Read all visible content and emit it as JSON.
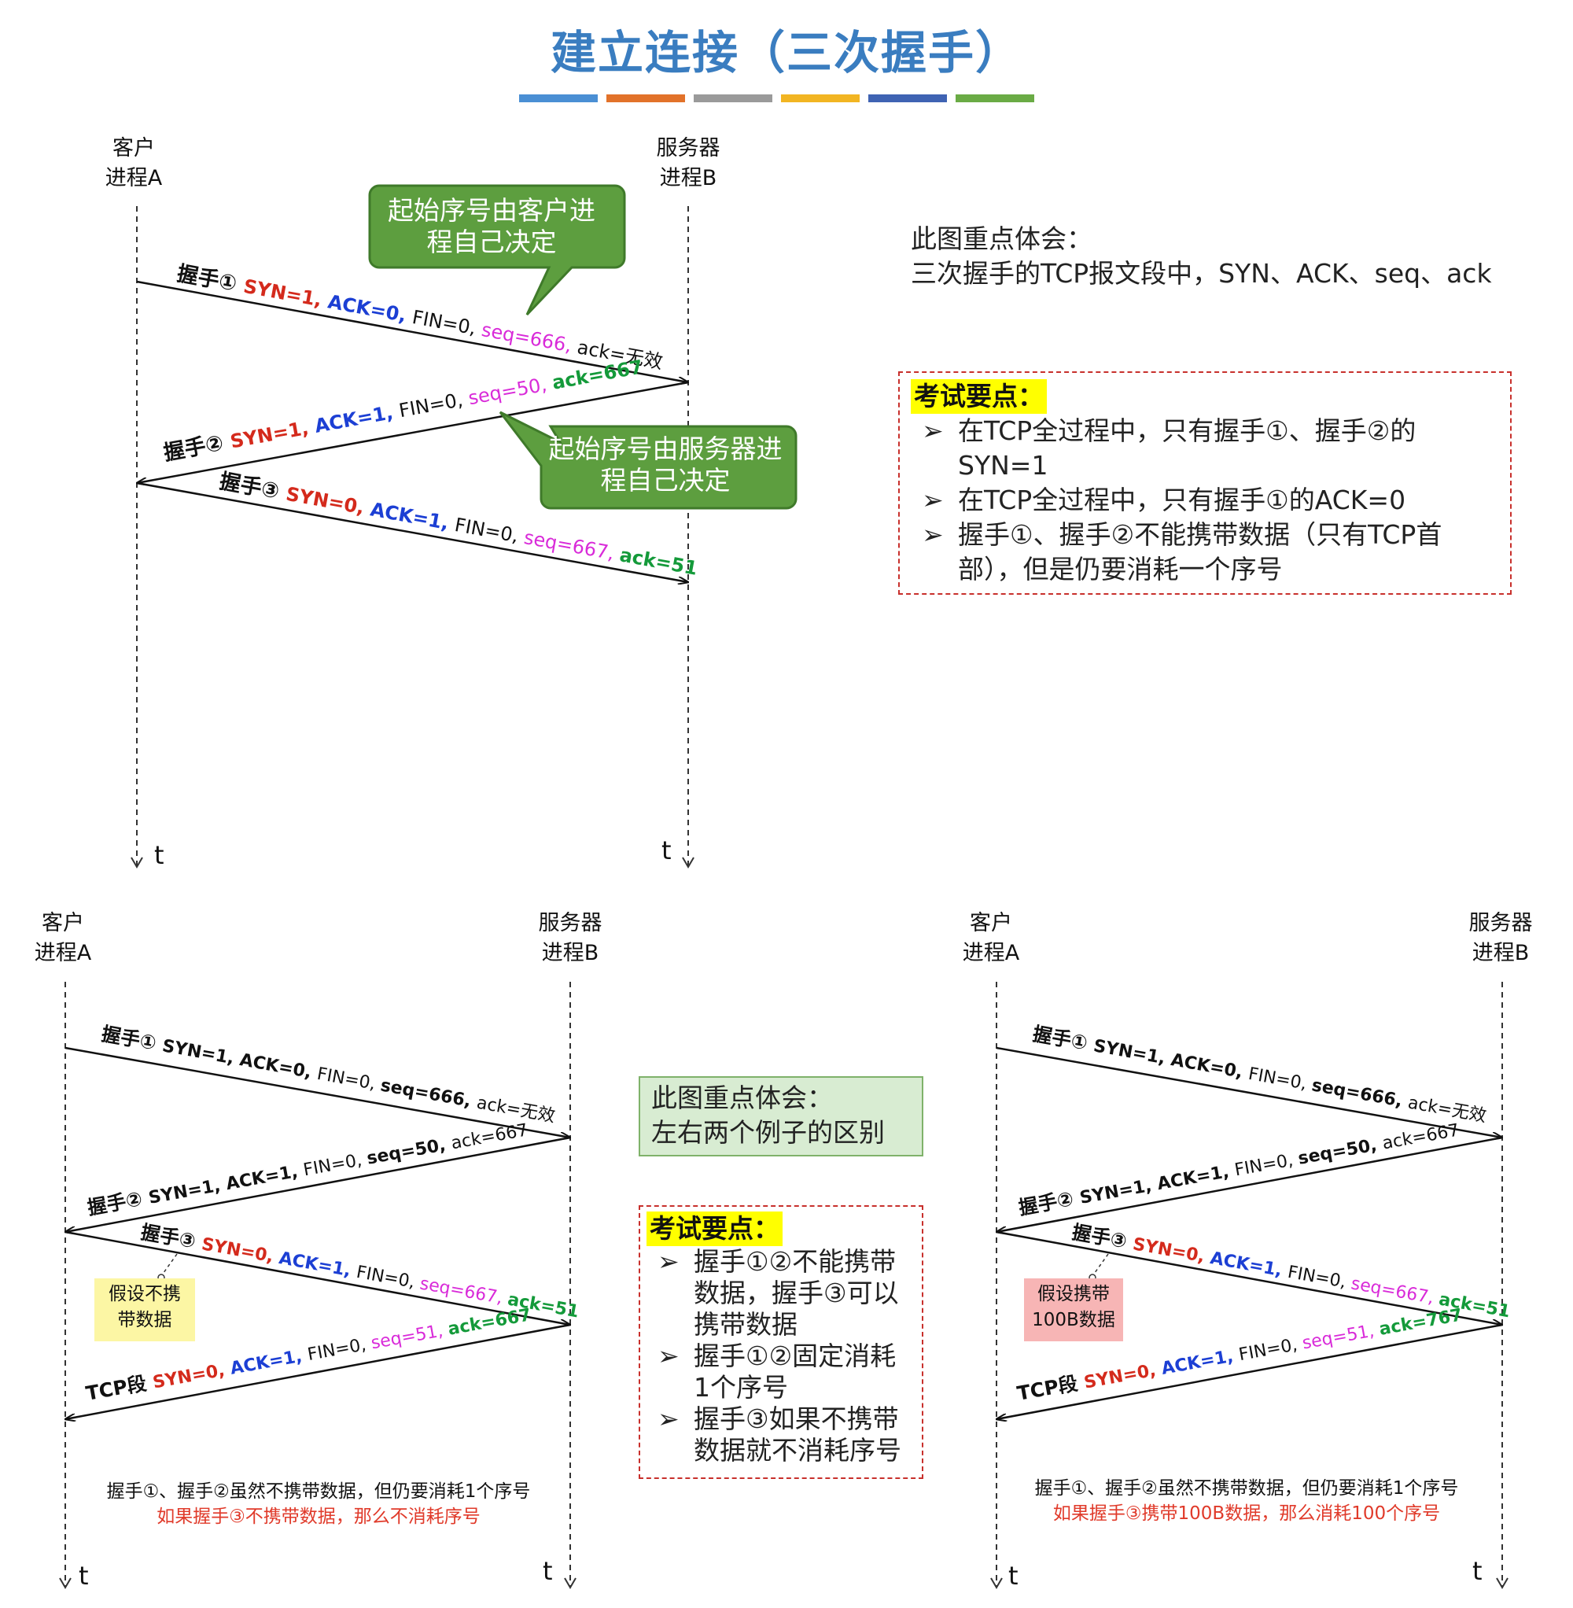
{
  "title": "建立连接（三次握手）",
  "title_bar_colors": [
    "#4a8fd4",
    "#e2722a",
    "#9a9a9a",
    "#f2b522",
    "#3f63b3",
    "#6aab45"
  ],
  "colors": {
    "syn": "#d42a1c",
    "ack": "#1c3fd4",
    "seq": "#d92bd9",
    "ack_val": "#149a3a",
    "bubble_fill": "#5d9e3f",
    "bubble_stroke": "#3f7a2a"
  },
  "top": {
    "client_label": [
      "客户",
      "进程A"
    ],
    "server_label": [
      "服务器",
      "进程B"
    ],
    "t_label": "t",
    "bubble1": "起始序号由客户进程自己决定",
    "bubble2": "起始序号由服务器进程自己决定",
    "msg1": {
      "name": "握手①",
      "syn": "SYN=1,",
      "ack": "ACK=0,",
      "fin": "FIN=0,",
      "seq": "seq=666,",
      "ackv": "ack=无效"
    },
    "msg2": {
      "name": "握手②",
      "syn": "SYN=1,",
      "ack": "ACK=1,",
      "fin": "FIN=0,",
      "seq": "seq=50,",
      "ackv": "ack=667"
    },
    "msg3": {
      "name": "握手③",
      "syn": "SYN=0,",
      "ack": "ACK=1,",
      "fin": "FIN=0,",
      "seq": "seq=667,",
      "ackv": "ack=51"
    }
  },
  "top_note": {
    "line1": "此图重点体会：",
    "line2": "三次握手的TCP报文段中，SYN、ACK、seq、ack"
  },
  "top_exam": {
    "heading": "考试要点：",
    "items": [
      [
        "在TCP全过程中，只有握手①、握手②的",
        "SYN=1"
      ],
      [
        "在TCP全过程中，只有握手①的ACK=0"
      ],
      [
        "握手①、握手②不能携带数据（只有TCP首",
        "部），但是仍要消耗一个序号"
      ]
    ]
  },
  "arrow_glyph": "➢",
  "left": {
    "client_label": [
      "客户",
      "进程A"
    ],
    "server_label": [
      "服务器",
      "进程B"
    ],
    "t_label": "t",
    "msg1": {
      "name": "握手①",
      "syn": "SYN=1,",
      "ack": "ACK=0,",
      "fin": "FIN=0,",
      "seq": "seq=666,",
      "ackv": "ack=无效"
    },
    "msg2": {
      "name": "握手②",
      "syn": "SYN=1,",
      "ack": "ACK=1,",
      "fin": "FIN=0,",
      "seq": "seq=50,",
      "ackv": "ack=667"
    },
    "msg3": {
      "name": "握手③",
      "syn": "SYN=0,",
      "ack": "ACK=1,",
      "fin": "FIN=0,",
      "seq": "seq=667,",
      "ackv": "ack=51"
    },
    "msg4": {
      "name": "TCP段",
      "syn": "SYN=0,",
      "ack": "ACK=1,",
      "fin": "FIN=0,",
      "seq": "seq=51,",
      "ackv": "ack=667"
    },
    "callout": [
      "假设不携",
      "带数据"
    ],
    "caption1": "握手①、握手②虽然不携带数据，但仍要消耗1个序号",
    "caption2": "如果握手③不携带数据，那么不消耗序号"
  },
  "right": {
    "client_label": [
      "客户",
      "进程A"
    ],
    "server_label": [
      "服务器",
      "进程B"
    ],
    "t_label": "t",
    "msg1": {
      "name": "握手①",
      "syn": "SYN=1,",
      "ack": "ACK=0,",
      "fin": "FIN=0,",
      "seq": "seq=666,",
      "ackv": "ack=无效"
    },
    "msg2": {
      "name": "握手②",
      "syn": "SYN=1,",
      "ack": "ACK=1,",
      "fin": "FIN=0,",
      "seq": "seq=50,",
      "ackv": "ack=667"
    },
    "msg3": {
      "name": "握手③",
      "syn": "SYN=0,",
      "ack": "ACK=1,",
      "fin": "FIN=0,",
      "seq": "seq=667,",
      "ackv": "ack=51"
    },
    "msg4": {
      "name": "TCP段",
      "syn": "SYN=0,",
      "ack": "ACK=1,",
      "fin": "FIN=0,",
      "seq": "seq=51,",
      "ackv": "ack=767"
    },
    "callout": [
      "假设携带",
      "100B数据"
    ],
    "caption1": "握手①、握手②虽然不携带数据，但仍要消耗1个序号",
    "caption2": "如果握手③携带100B数据，那么消耗100个序号"
  },
  "mid_note": {
    "line1": "此图重点体会：",
    "line2": "左右两个例子的区别"
  },
  "mid_exam": {
    "heading": "考试要点：",
    "items": [
      [
        "握手①②不能携带",
        "数据，握手③可以",
        "携带数据"
      ],
      [
        "握手①②固定消耗",
        "1个序号"
      ],
      [
        "握手③如果不携带",
        "数据就不消耗序号"
      ]
    ]
  }
}
